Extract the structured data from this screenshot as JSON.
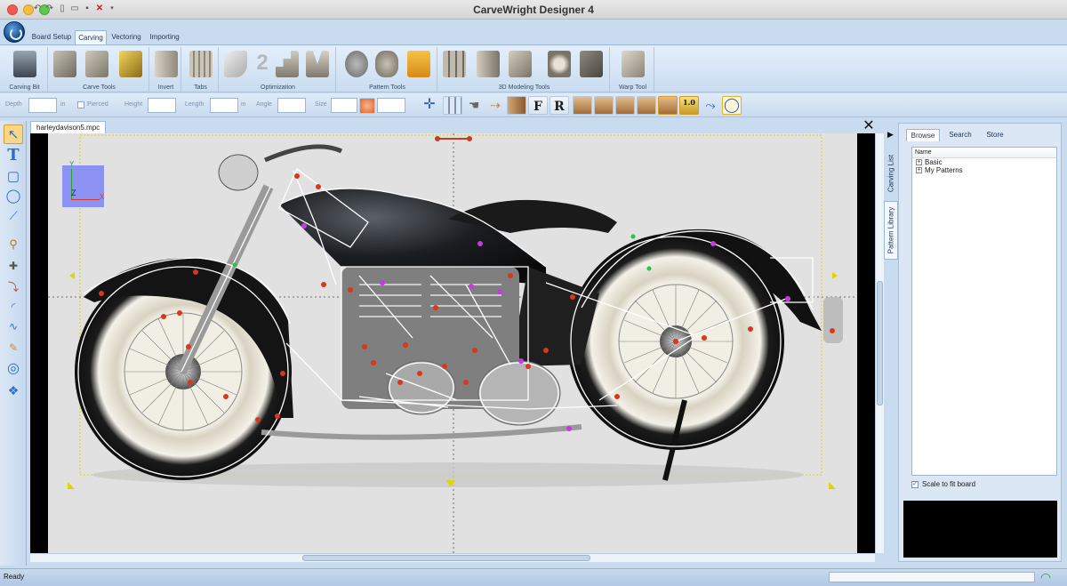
{
  "window": {
    "title": "CarveWright Designer 4"
  },
  "ribbon": {
    "tabs": [
      "Board Setup",
      "Carving",
      "Vectoring",
      "Importing"
    ],
    "active_tab": "Carving",
    "groups": [
      "Carving Bit",
      "Carve Tools",
      "Invert",
      "Tabs",
      "Optimization",
      "Pattern Tools",
      "3D Modeling Tools",
      "Warp Tool"
    ]
  },
  "options_bar": {
    "depth_label": "Depth",
    "depth_unit": "in",
    "pierced_label": "Pierced",
    "height_label": "Height",
    "length_label": "Length",
    "length_unit": "in",
    "angle_label": "Angle",
    "size_label": "Size",
    "font_bold_label": "F",
    "font_regular_label": "R",
    "ten_label": "1.0"
  },
  "document": {
    "tab_title": "harleydavison5.mpc",
    "close_label": "✕"
  },
  "canvas": {
    "axis_y": "Y",
    "axis_z": "Z",
    "axis_x": "X"
  },
  "right_panel": {
    "side_tabs": [
      "Carving List",
      "Pattern Library"
    ],
    "tabs": [
      "Browse",
      "Search",
      "Store"
    ],
    "active_tab": "Browse",
    "tree_header": "Name",
    "tree_items": [
      "Basic",
      "My Patterns"
    ],
    "scale_to_fit_label": "Scale to fit board",
    "scale_to_fit_checked": true
  },
  "status": {
    "text": "Ready"
  },
  "colors": {
    "ribbon": "#d3e3f5",
    "canvas_bg": "#e1e1e1",
    "vector_control_point": "#d9361e",
    "vector_magenta_point": "#c33be0",
    "board_outline": "#e0d500"
  }
}
